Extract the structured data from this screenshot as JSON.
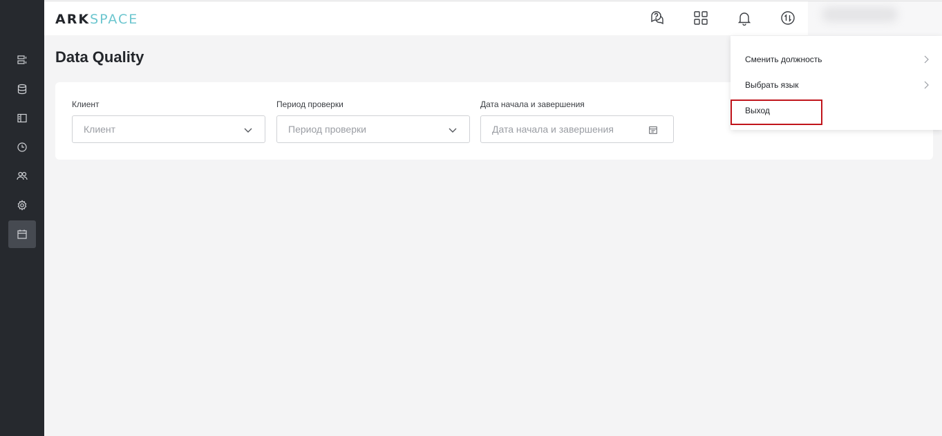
{
  "logo": {
    "part1": "ARK",
    "part2": "SPACE"
  },
  "page": {
    "title": "Data Quality"
  },
  "sidebar": {
    "items": [
      {
        "icon": "list-icon"
      },
      {
        "icon": "database-icon"
      },
      {
        "icon": "panel-icon"
      },
      {
        "icon": "clock-icon"
      },
      {
        "icon": "users-icon"
      },
      {
        "icon": "gear-icon"
      },
      {
        "icon": "calendar-icon",
        "active": true
      }
    ]
  },
  "header": {
    "icons": [
      "help-chat-icon",
      "apps-grid-icon",
      "bell-icon",
      "switch-icon"
    ]
  },
  "filters": {
    "client": {
      "label": "Клиент",
      "placeholder": "Клиент"
    },
    "period": {
      "label": "Период проверки",
      "placeholder": "Период проверки"
    },
    "dates": {
      "label": "Дата начала и завершения",
      "placeholder": "Дата начала и завершения"
    }
  },
  "user_menu": {
    "change_position": "Сменить должность",
    "choose_language": "Выбрать язык",
    "logout": "Выход"
  },
  "colors": {
    "sidebar": "#26292e",
    "accent": "#6cc6cf",
    "highlight": "#c0141b"
  }
}
